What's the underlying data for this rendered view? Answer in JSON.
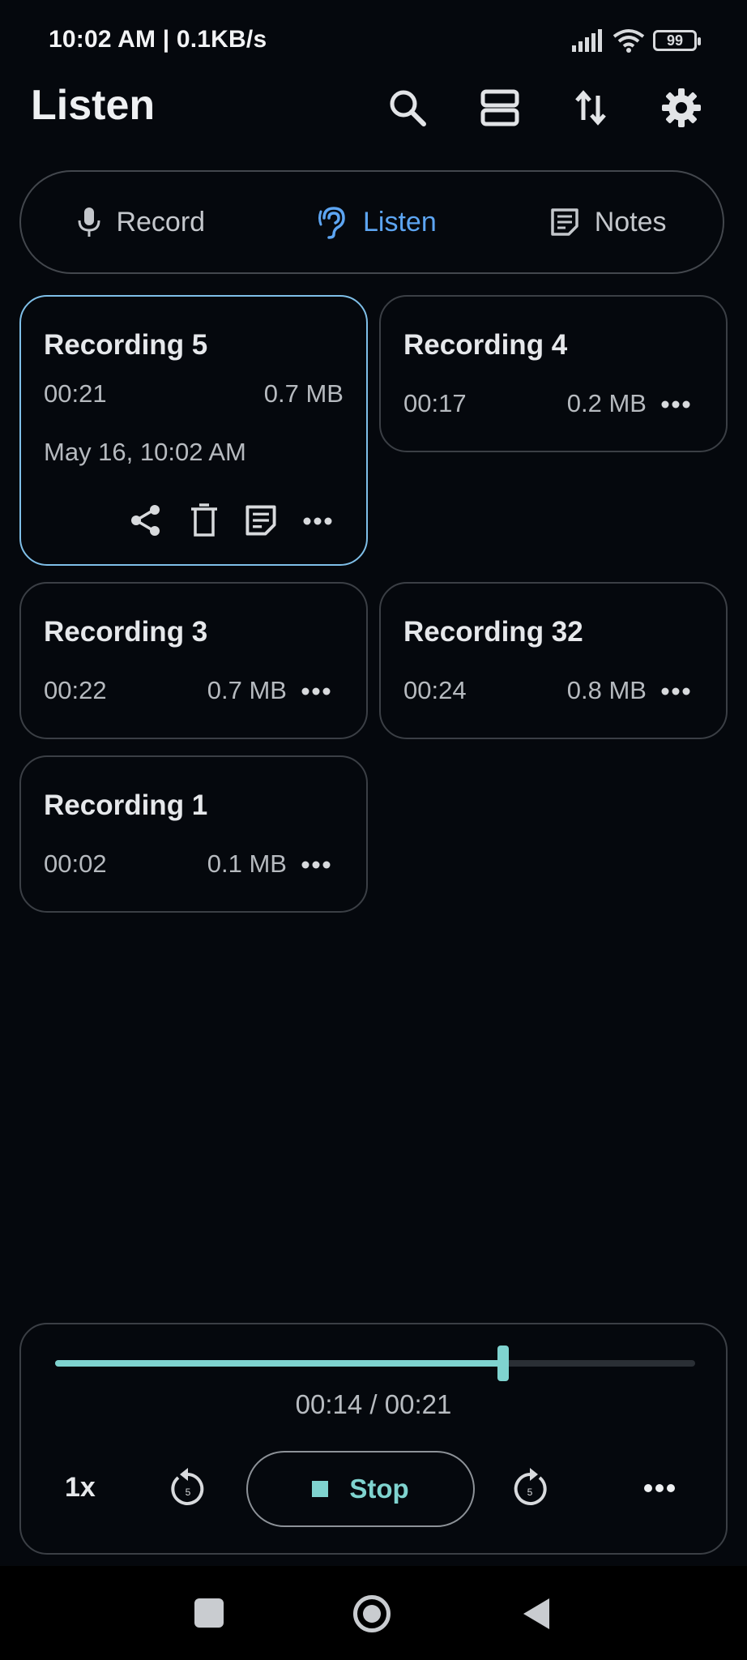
{
  "status_bar": {
    "time_speed": "10:02 AM | 0.1KB/s",
    "battery": "99",
    "icons": [
      "signal-icon",
      "wifi-icon",
      "battery-icon"
    ]
  },
  "header": {
    "title": "Listen",
    "actions": [
      "search-icon",
      "view-layout-icon",
      "sort-icon",
      "settings-icon"
    ]
  },
  "tabs": [
    {
      "label": "Record",
      "icon": "mic-icon",
      "active": false
    },
    {
      "label": "Listen",
      "icon": "ear-icon",
      "active": true
    },
    {
      "label": "Notes",
      "icon": "notes-icon",
      "active": false
    }
  ],
  "recordings": [
    {
      "title": "Recording 5",
      "duration": "00:21",
      "size": "0.7 MB",
      "date": "May 16, 10:02 AM",
      "selected": true
    },
    {
      "title": "Recording 4",
      "duration": "00:17",
      "size": "0.2 MB"
    },
    {
      "title": "Recording 3",
      "duration": "00:22",
      "size": "0.7 MB"
    },
    {
      "title": "Recording 32",
      "duration": "00:24",
      "size": "0.8 MB"
    },
    {
      "title": "Recording 1",
      "duration": "00:02",
      "size": "0.1 MB"
    }
  ],
  "player": {
    "progress": 0.7,
    "time": "00:14 / 00:21",
    "speed": "1x",
    "rewind_seconds": "5",
    "forward_seconds": "5",
    "stop_label": "Stop"
  },
  "colors": {
    "background": "#05080d",
    "accent_blue": "#5da5f2",
    "accent_teal": "#7fd3cf",
    "selected_border": "#7fbfe8",
    "card_border": "#3b3f45"
  }
}
